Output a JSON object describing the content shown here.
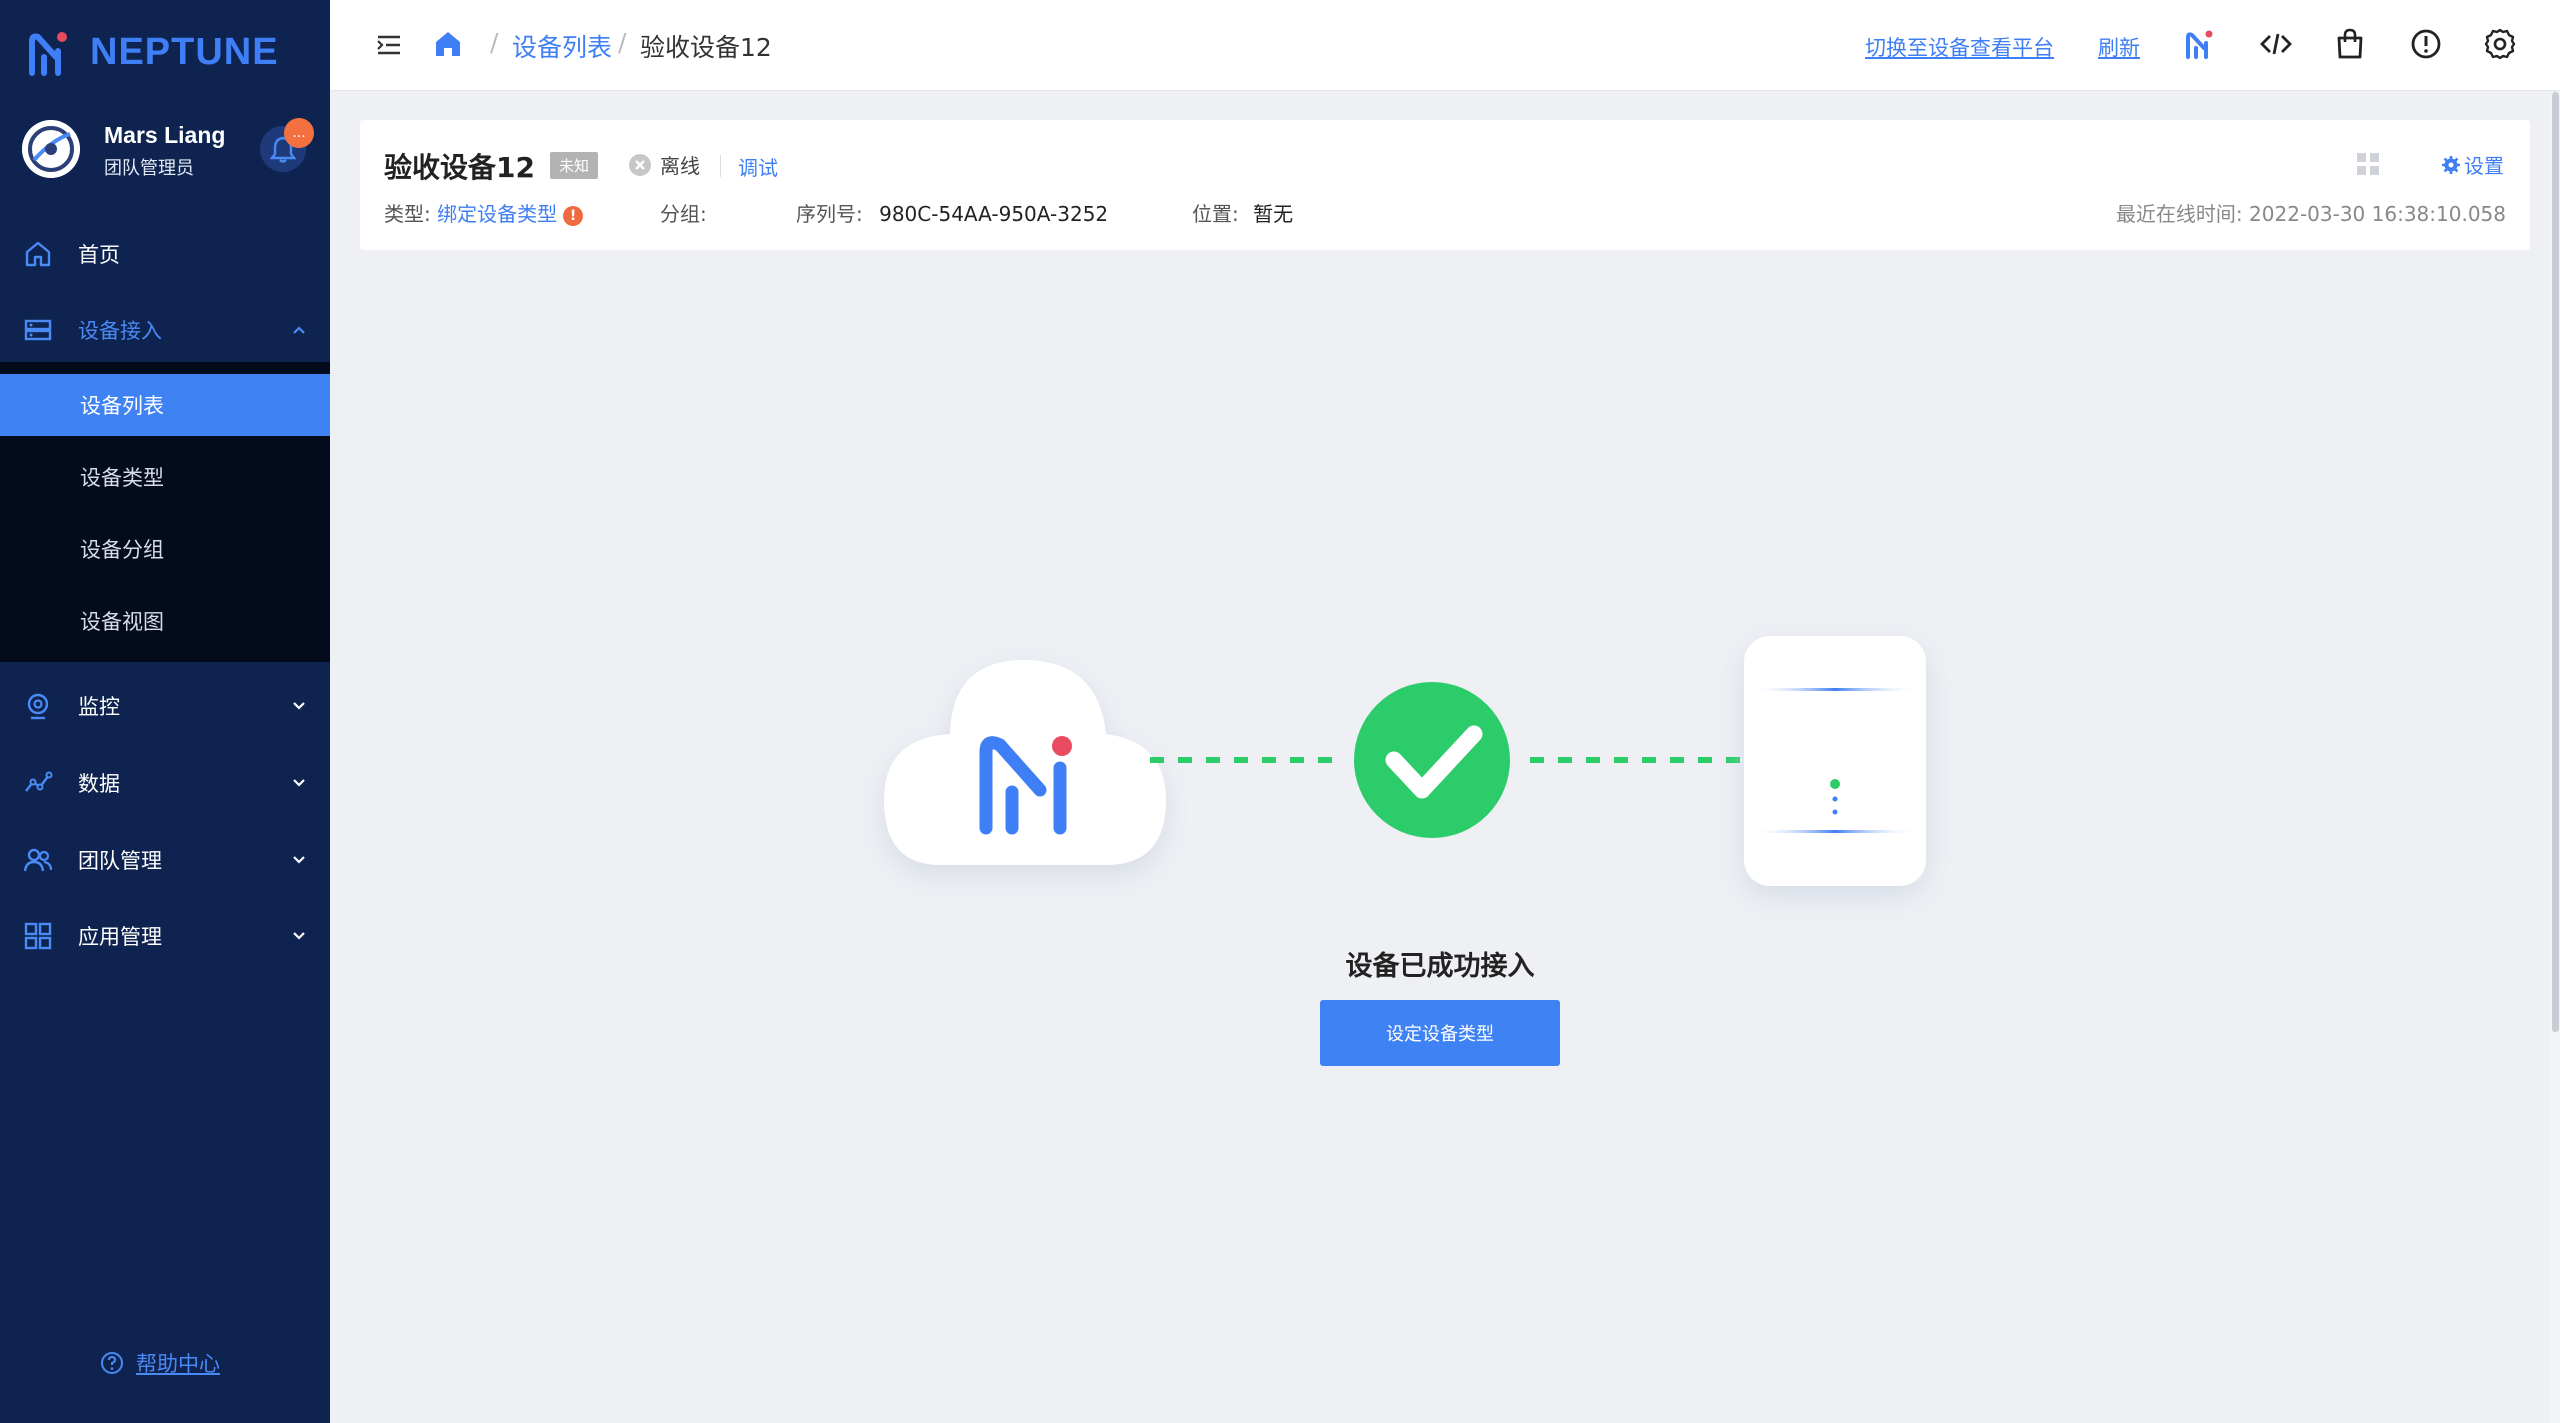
{
  "app": {
    "brand": "NEPTUNE",
    "brand_color": "#3f7ff5"
  },
  "user": {
    "name": "Mars Liang",
    "role": "团队管理员",
    "notification_badge": "..."
  },
  "sidebar": {
    "items": [
      {
        "label": "首页",
        "icon": "home-icon"
      },
      {
        "label": "设备接入",
        "icon": "device-access-icon",
        "expanded": true
      },
      {
        "label": "监控",
        "icon": "monitor-icon"
      },
      {
        "label": "数据",
        "icon": "data-icon"
      },
      {
        "label": "团队管理",
        "icon": "team-icon"
      },
      {
        "label": "应用管理",
        "icon": "apps-icon"
      }
    ],
    "submenu": [
      {
        "label": "设备列表",
        "selected": true
      },
      {
        "label": "设备类型"
      },
      {
        "label": "设备分组"
      },
      {
        "label": "设备视图"
      }
    ],
    "help": "帮助中心"
  },
  "header": {
    "breadcrumb": {
      "sep": "/",
      "parent": "设备列表",
      "current": "验收设备12"
    },
    "switch_platform": "切换至设备查看平台",
    "refresh": "刷新"
  },
  "device": {
    "name": "验收设备12",
    "badge": "未知",
    "status": "离线",
    "debug": "调试",
    "type_label": "类型:",
    "type_value": "绑定设备类型",
    "group_label": "分组:",
    "serial_label": "序列号:",
    "serial_value": "980C-54AA-950A-3252",
    "location_label": "位置:",
    "location_value": "暂无",
    "settings": "设置",
    "last_online_label": "最近在线时间:",
    "last_online_value": "2022-03-30 16:38:10.058"
  },
  "main": {
    "success_text": "设备已成功接入",
    "action_button": "设定设备类型"
  },
  "colors": {
    "sidebar_bg": "#0e2350",
    "accent": "#3f82f4",
    "success": "#2dcc6a",
    "warning": "#f06a3f"
  }
}
